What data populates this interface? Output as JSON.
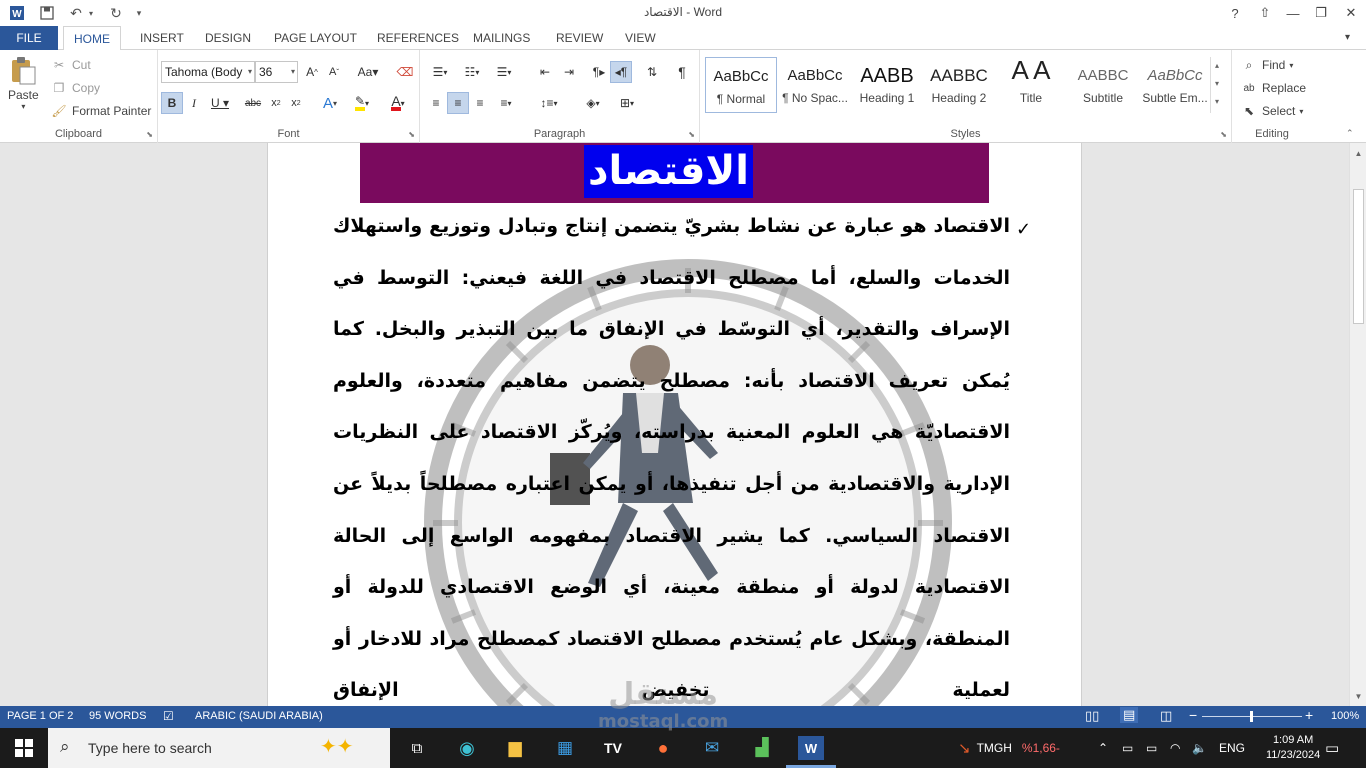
{
  "titlebar": {
    "title": "الاقتصاد - Word",
    "help": "?",
    "restore_ribbon": "⇧",
    "minimize": "—",
    "maximize": "❐",
    "close": "✕"
  },
  "tabs": [
    "FILE",
    "HOME",
    "INSERT",
    "DESIGN",
    "PAGE LAYOUT",
    "REFERENCES",
    "MAILINGS",
    "REVIEW",
    "VIEW"
  ],
  "ribbon": {
    "clipboard": {
      "paste": "Paste",
      "cut": "Cut",
      "copy": "Copy",
      "format_painter": "Format Painter",
      "label": "Clipboard"
    },
    "font": {
      "family": "Tahoma (Body",
      "size": "36",
      "label": "Font"
    },
    "paragraph": {
      "label": "Paragraph"
    },
    "styles": {
      "label": "Styles",
      "items": [
        {
          "preview": "AaBbCc",
          "name": "¶ Normal"
        },
        {
          "preview": "AaBbCc",
          "name": "¶ No Spac..."
        },
        {
          "preview": "AABB",
          "name": "Heading 1"
        },
        {
          "preview": "AABBC",
          "name": "Heading 2"
        },
        {
          "preview": "A A",
          "name": "Title"
        },
        {
          "preview": "AABBC",
          "name": "Subtitle"
        },
        {
          "preview": "AaBbCc",
          "name": "Subtle Em..."
        }
      ]
    },
    "editing": {
      "find": "Find",
      "replace": "Replace",
      "select": "Select",
      "label": "Editing"
    }
  },
  "document": {
    "title": "الاقتصاد",
    "body": "الاقتصاد هو عبارة عن نشاط بشريّ يتضمن إنتاج وتبادل وتوزيع واستهلاك الخدمات والسلع، أما مصطلح الاقتصاد في اللغة فيعني: التوسط في الإسراف والتقدير، أي التوسّط في الإنفاق ما بين التبذير والبخل. كما يُمكن تعريف الاقتصاد بأنه: مصطلح يتضمن مفاهيم متعددة، والعلوم الاقتصاديّة هي العلوم المعنية بدراسته، ويُركّز الاقتصاد على النظريات الإدارية والاقتصادية من أجل تنفيذها، أو يمكن اعتباره مصطلحاً بديلاً عن الاقتصاد السياسي. كما يشير الاقتصاد بمفهومه الواسع إلى الحالة الاقتصادية لدولة أو منطقة معينة، أي الوضع الاقتصادي للدولة أو المنطقة، وبشكل عام يُستخدم مصطلح الاقتصاد كمصطلح مراد للادخار أو لعملية تخفيض الإنفاق"
  },
  "statusbar": {
    "page": "PAGE 1 OF 2",
    "words": "95 WORDS",
    "language": "ARABIC (SAUDI ARABIA)",
    "zoom": "100%"
  },
  "taskbar": {
    "search_placeholder": "Type here to search",
    "ticker": "TMGH",
    "ticker_change": "%1,66-",
    "lang": "ENG",
    "time": "1:09 AM",
    "date": "11/23/2024"
  },
  "watermark": {
    "arabic": "مستقل",
    "latin": "mostaql.com"
  }
}
